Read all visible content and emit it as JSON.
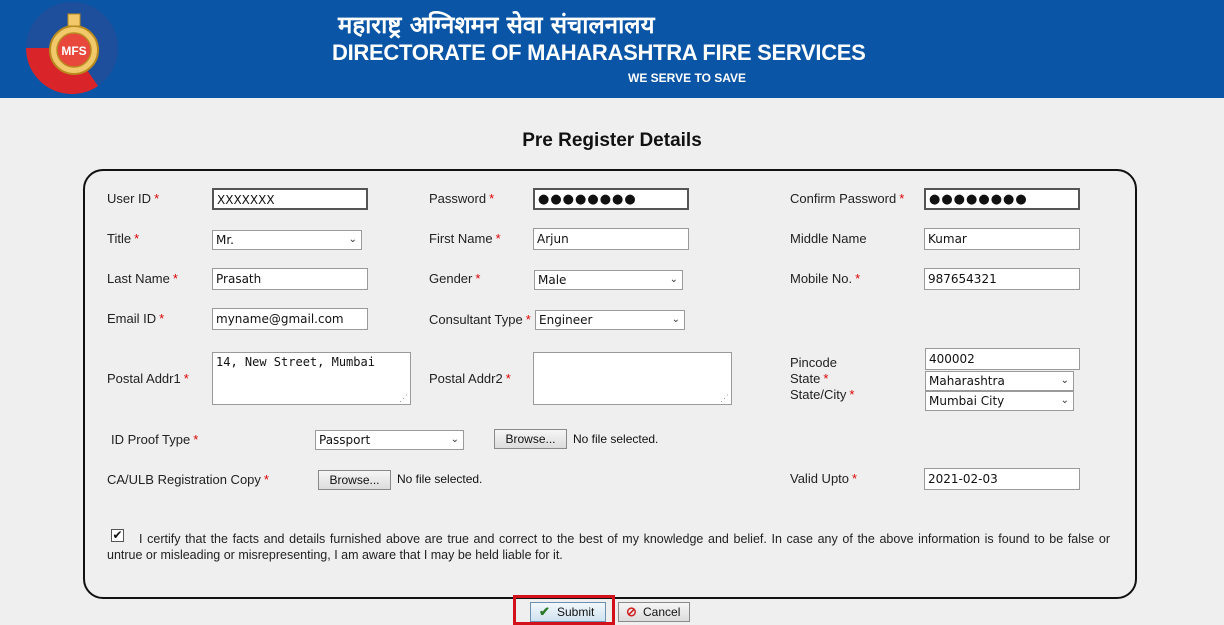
{
  "header": {
    "title_hindi": "महाराष्ट्र अग्निशमन सेवा संचालनालय",
    "title": "DIRECTORATE OF MAHARASHTRA FIRE SERVICES",
    "tagline": "WE SERVE TO SAVE",
    "logo_text": "MFS",
    "background_color": "#0a55a5"
  },
  "page_title": "Pre Register Details",
  "form": {
    "required_mark": "*",
    "user_id": {
      "label": "User ID",
      "value": "XXXXXXX"
    },
    "password": {
      "label": "Password",
      "value": "●●●●●●●●"
    },
    "confirm_password": {
      "label": "Confirm Password",
      "value": "●●●●●●●●"
    },
    "title": {
      "label": "Title",
      "value": "Mr."
    },
    "first_name": {
      "label": "First Name",
      "value": "Arjun"
    },
    "middle_name": {
      "label": "Middle Name",
      "value": "Kumar"
    },
    "last_name": {
      "label": "Last Name",
      "value": "Prasath"
    },
    "gender": {
      "label": "Gender",
      "value": "Male"
    },
    "mobile": {
      "label": "Mobile No.",
      "value": "987654321"
    },
    "email": {
      "label": "Email ID",
      "value": "myname@gmail.com"
    },
    "consultant_type": {
      "label": "Consultant Type",
      "value": "Engineer"
    },
    "postal_addr1": {
      "label": "Postal Addr1",
      "value": "14, New Street, Mumbai"
    },
    "postal_addr2": {
      "label": "Postal Addr2",
      "value": ""
    },
    "pincode": {
      "label": "Pincode",
      "value": "400002"
    },
    "state": {
      "label": "State",
      "value": "Maharashtra"
    },
    "state_city": {
      "label": "State/City",
      "value": "Mumbai City"
    },
    "id_proof_type": {
      "label": "ID Proof Type",
      "value": "Passport",
      "browse_label": "Browse...",
      "file_status": "No file selected."
    },
    "ca_ulb_copy": {
      "label": "CA/ULB Registration Copy",
      "browse_label": "Browse...",
      "file_status": "No file selected."
    },
    "valid_upto": {
      "label": "Valid Upto",
      "value": "2021-02-03"
    },
    "certify": {
      "checked": true,
      "text": "I certify that the facts and details furnished above are true and correct to the best of my knowledge and belief. In case any of the above information is found to be false or untrue or misleading or misrepresenting, I am aware that I may be held liable for it."
    }
  },
  "buttons": {
    "submit_label": "Submit",
    "cancel_label": "Cancel",
    "highlight_color": "#d2111a"
  },
  "icons": {
    "dropdown": "chevron-down-icon",
    "submit": "check-icon",
    "cancel": "ban-icon"
  }
}
